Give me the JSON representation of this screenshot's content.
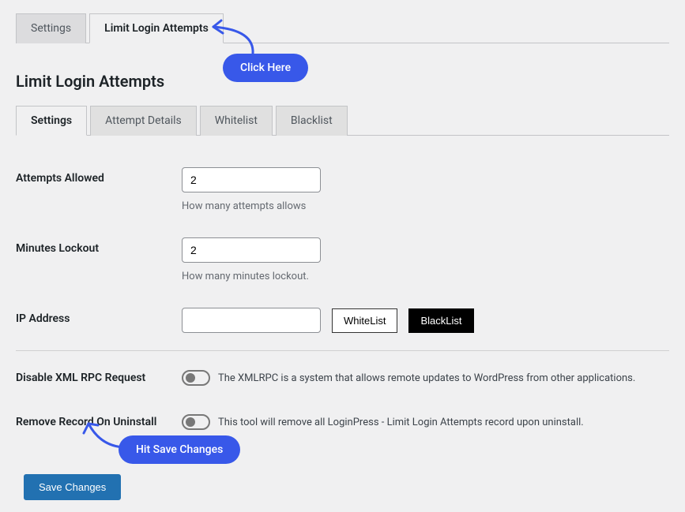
{
  "topTabs": {
    "settings": "Settings",
    "limitLogin": "Limit Login Attempts"
  },
  "pageTitle": "Limit Login Attempts",
  "subTabs": {
    "settings": "Settings",
    "attemptDetails": "Attempt Details",
    "whitelist": "Whitelist",
    "blacklist": "Blacklist"
  },
  "attemptsAllowed": {
    "label": "Attempts Allowed",
    "value": "2",
    "help": "How many attempts allows"
  },
  "minutesLockout": {
    "label": "Minutes Lockout",
    "value": "2",
    "help": "How many minutes lockout."
  },
  "ipAddress": {
    "label": "IP Address",
    "value": "",
    "whitelist": "WhiteList",
    "blacklist": "BlackList"
  },
  "disableXmlRpc": {
    "label": "Disable XML RPC Request",
    "desc": "The XMLRPC is a system that allows remote updates to WordPress from other applications."
  },
  "removeRecord": {
    "label": "Remove Record On Uninstall",
    "desc": "This tool will remove all LoginPress - Limit Login Attempts record upon uninstall."
  },
  "saveButton": "Save Changes",
  "callouts": {
    "clickHere": "Click Here",
    "hitSave": "Hit Save Changes"
  }
}
